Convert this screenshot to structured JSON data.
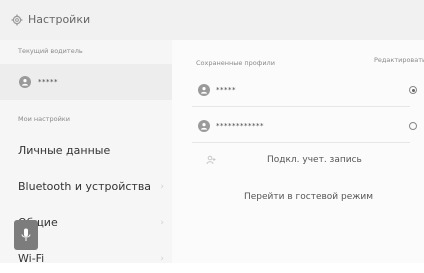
{
  "header": {
    "title": "Настройки",
    "icon": "gear-icon"
  },
  "left": {
    "current_driver_label": "Текущий водитель",
    "current_driver_name": "*****",
    "my_settings_label": "Мои настройки",
    "menu": [
      {
        "label": "Личные данные"
      },
      {
        "label": "Bluetooth и устройства"
      },
      {
        "label": "Общие"
      },
      {
        "label": "Wi-Fi"
      }
    ],
    "chevron": "›"
  },
  "right": {
    "saved_profiles_label": "Сохраненные профили",
    "edit_label": "Редактировать",
    "profiles": [
      {
        "name": "*****",
        "selected": true
      },
      {
        "name": "************",
        "selected": false
      }
    ],
    "link_account_label": "Подкл. учет. запись",
    "guest_mode_label": "Перейти в гостевой режим"
  },
  "colors": {
    "accent": "#7c7c7c",
    "background": "#fbfbfb"
  }
}
